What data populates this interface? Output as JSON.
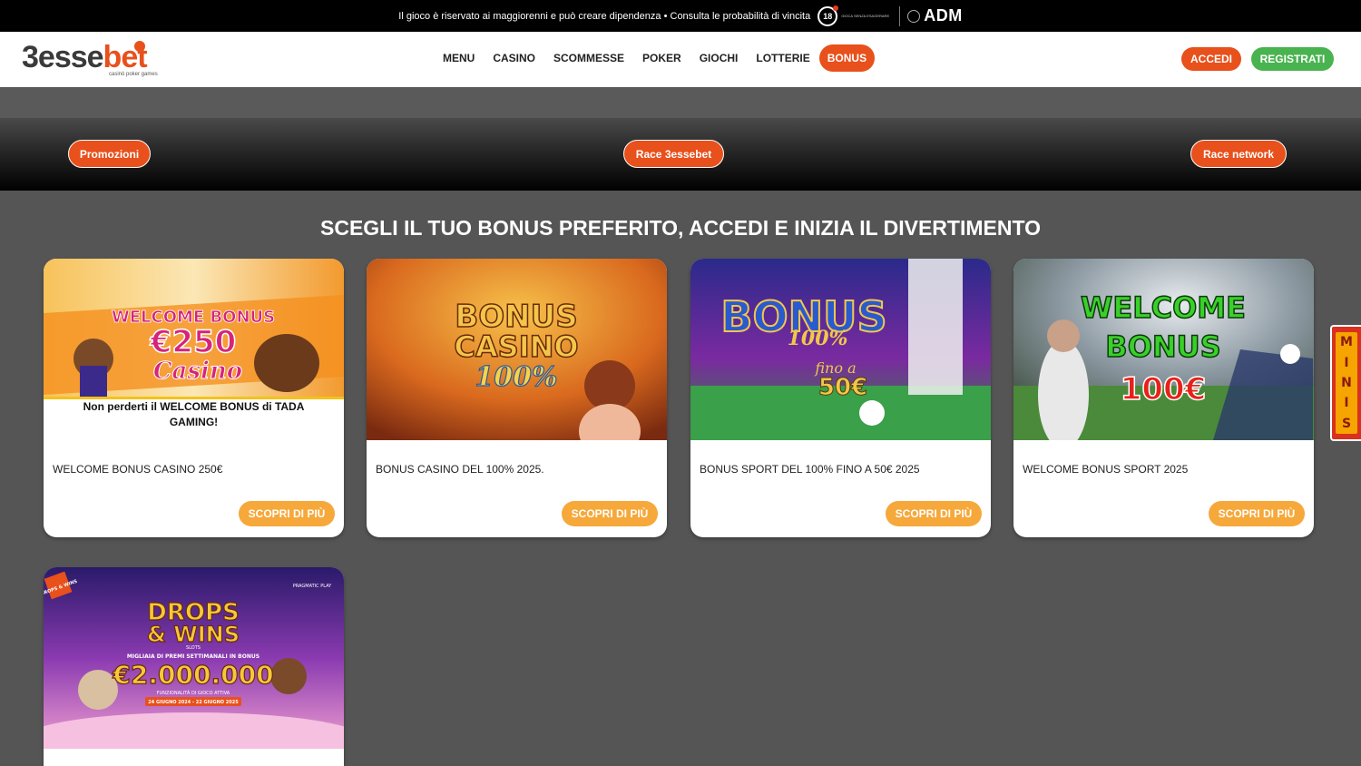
{
  "topbar": {
    "disclaimer": "Il gioco è riservato ai maggiorenni e può creare dipendenza • Consulta le probabilità di vincita",
    "age": "18",
    "age_text": "gioca senza esagerare",
    "regulator": "ADM"
  },
  "header": {
    "logo": {
      "part1": "3esse",
      "part2": "bet",
      "tagline": "casinò poker games"
    },
    "nav": [
      {
        "label": "MENU"
      },
      {
        "label": "CASINO"
      },
      {
        "label": "SCOMMESSE"
      },
      {
        "label": "POKER"
      },
      {
        "label": "GIOCHI"
      },
      {
        "label": "LOTTERIE"
      },
      {
        "label": "BONUS"
      }
    ],
    "login_label": "ACCEDI",
    "register_label": "REGISTRATI"
  },
  "subnav": {
    "items": [
      {
        "label": "Promozioni"
      },
      {
        "label": "Race 3essebet"
      },
      {
        "label": "Race network"
      }
    ]
  },
  "heading": "SCEGLI IL TUO BONUS PREFERITO, ACCEDI E INIZIA IL DIVERTIMENTO",
  "cards": [
    {
      "banner_line1": "WELCOME BONUS",
      "banner_line2": "€250",
      "banner_line3": "Casino",
      "promo": "Non perderti il WELCOME BONUS di TADA GAMING!",
      "desc": "WELCOME BONUS CASINO 250€",
      "cta": "SCOPRI DI PIÙ"
    },
    {
      "banner_line1": "BONUS",
      "banner_line2": "CASINO",
      "banner_line3": "100%",
      "desc": "BONUS CASINO DEL 100% 2025.",
      "cta": "SCOPRI DI PIÙ"
    },
    {
      "banner_line1": "BONUS",
      "banner_line2": "100%",
      "banner_line3": "fino a",
      "banner_line4": "50€",
      "desc": "BONUS SPORT DEL 100% FINO A 50€ 2025",
      "cta": "SCOPRI DI PIÙ"
    },
    {
      "banner_line1": "WELCOME",
      "banner_line2": "BONUS",
      "banner_line3": "100€",
      "desc": "WELCOME BONUS SPORT 2025",
      "cta": "SCOPRI DI PIÙ"
    },
    {
      "banner_line1": "DROPS",
      "banner_line2": "& WINS",
      "banner_line3": "SLOTS",
      "banner_line4": "MIGLIAIA DI PREMI SETTIMANALI IN BONUS",
      "banner_line5": "€2.000.000",
      "banner_line6": "FUNZIONALITÀ DI GIOCO ATTIVA",
      "banner_line7": "24 GIUGNO 2024 - 22 GIUGNO 2025",
      "badge": "DROPS & WINS",
      "provider": "PRAGMATIC PLAY"
    }
  ],
  "minis": {
    "letters": [
      "M",
      "I",
      "N",
      "I",
      "S"
    ]
  },
  "colors": {
    "accent": "#e8501c",
    "register": "#49b34f",
    "cta": "#f6a83a",
    "background": "#555555"
  }
}
